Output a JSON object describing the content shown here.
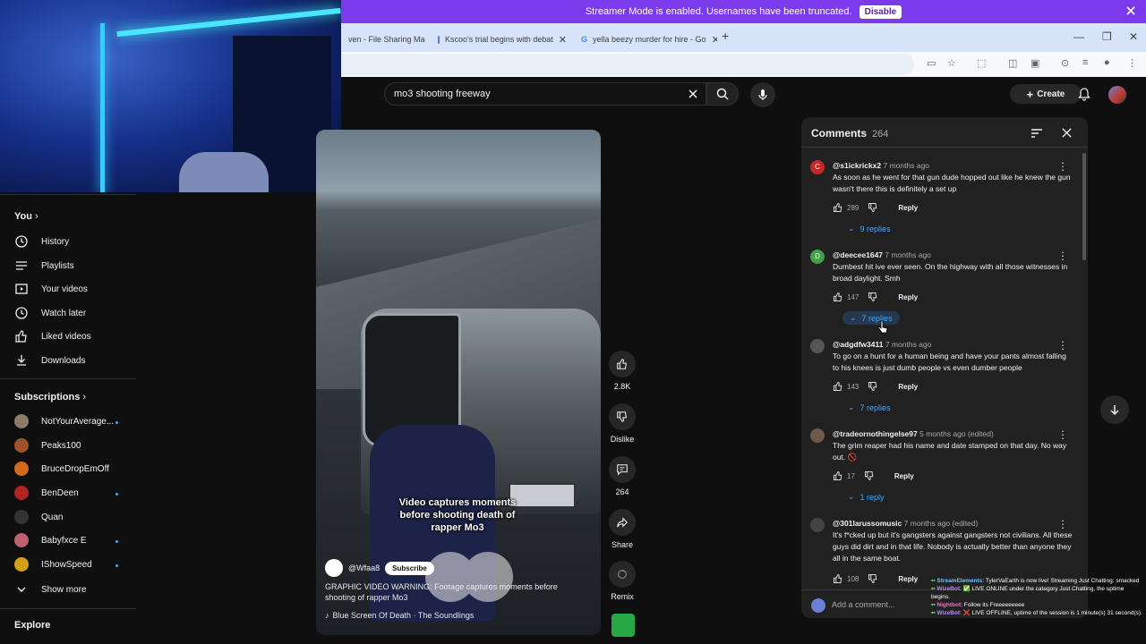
{
  "streamer_banner": {
    "message": "Streamer Mode is enabled. Usernames have been truncated.",
    "disable_label": "Disable"
  },
  "browser": {
    "tabs": [
      {
        "title": "ven - File Sharing Ma"
      },
      {
        "title": "Kscoo's trial begins with debat"
      },
      {
        "title": "yella beezy murder for hire - Go"
      }
    ],
    "new_tab": "+"
  },
  "youtube": {
    "search_value": "mo3 shooting freeway",
    "create_label": "Create"
  },
  "sidebar": {
    "you_label": "You",
    "you_items": [
      {
        "label": "History",
        "icon": "history-icon"
      },
      {
        "label": "Playlists",
        "icon": "playlists-icon"
      },
      {
        "label": "Your videos",
        "icon": "your-videos-icon"
      },
      {
        "label": "Watch later",
        "icon": "watch-later-icon"
      },
      {
        "label": "Liked videos",
        "icon": "liked-videos-icon"
      },
      {
        "label": "Downloads",
        "icon": "downloads-icon"
      }
    ],
    "subscriptions_label": "Subscriptions",
    "subscriptions": [
      {
        "name": "NotYourAverage...",
        "color": "#8a7b6a",
        "live_dot": true
      },
      {
        "name": "Peaks100",
        "color": "#a0522d",
        "live_dot": false
      },
      {
        "name": "BruceDropEmOff",
        "color": "#d2691e",
        "live_dot": false
      },
      {
        "name": "BenDeen",
        "color": "#b22222",
        "live_dot": true
      },
      {
        "name": "Quan",
        "color": "#333333",
        "live_dot": false
      },
      {
        "name": "Babyfxce E",
        "color": "#c06070",
        "live_dot": true
      },
      {
        "name": "IShowSpeed",
        "color": "#d4a017",
        "live_dot": true
      }
    ],
    "show_more": "Show more",
    "explore": "Explore"
  },
  "video": {
    "caption": "Video captures moments before shooting death of rapper Mo3",
    "channel": "@Wfaa8",
    "subscribe": "Subscribe",
    "title": "GRAPHIC VIDEO WARNING: Footage captures moments before shooting of rapper Mo3",
    "music": "Blue Screen Of Death · The Soundlings",
    "like_count": "2.8K",
    "dislike_label": "Dislike",
    "comment_count": "264",
    "share_label": "Share",
    "remix_label": "Remix"
  },
  "comments_panel": {
    "title": "Comments",
    "count": "264",
    "add_placeholder": "Add a comment...",
    "reply_label": "Reply",
    "comments": [
      {
        "user": "@s1ickrickx2",
        "time": "7 months ago",
        "text": "As soon as he went for that gun dude hopped out like he knew the gun wasn't there this is definitely a set up",
        "likes": "289",
        "replies": "9 replies",
        "avatar_letter": "C",
        "avatar_color": "#c62828"
      },
      {
        "user": "@deecee1647",
        "time": "7 months ago",
        "text": "Dumbest hit ive ever seen. On the highway with all those witnesses in broad daylight. Smh",
        "likes": "147",
        "replies": "7 replies",
        "avatar_letter": "D",
        "avatar_color": "#43a047"
      },
      {
        "user": "@adgdfw3411",
        "time": "7 months ago",
        "text": "To go on a hunt for a human being and have your pants almost falling to his knees is just  dumb people vs even dumber people",
        "likes": "143",
        "replies": "7 replies",
        "avatar_letter": "",
        "avatar_color": "#555555"
      },
      {
        "user": "@tradeornothingelse97",
        "time": "5 months ago (edited)",
        "text": "The grim reaper had his name and date stamped on that day. No way out. 🚫",
        "likes": "17",
        "replies": "1 reply",
        "avatar_letter": "",
        "avatar_color": "#6d5a4a"
      },
      {
        "user": "@301larussomusic",
        "time": "7 months ago (edited)",
        "text": "It's f*cked up but it's gangsters against gangsters not civilians. All these guys did dirt and in that life. Nobody is actually better than anyone they all in the same boat.",
        "likes": "108",
        "replies": "",
        "avatar_letter": "",
        "avatar_color": "#444444"
      }
    ]
  },
  "chat": [
    {
      "name": "StreamElements",
      "msg": ": TylerVaEarth is now live! Streaming Just Chatting: smacked"
    },
    {
      "name": "WizeBot",
      "msg": ": ✅ LIVE ONLINE under the category Just Chatting, the uptime begins."
    },
    {
      "name": "Nightbot",
      "msg": ": Follow its Freeeeeeeee"
    },
    {
      "name": "WizeBot",
      "msg": ": ❌ LIVE OFFLINE, uptime of the session is 1 minute(s) 31 second(s)."
    }
  ]
}
